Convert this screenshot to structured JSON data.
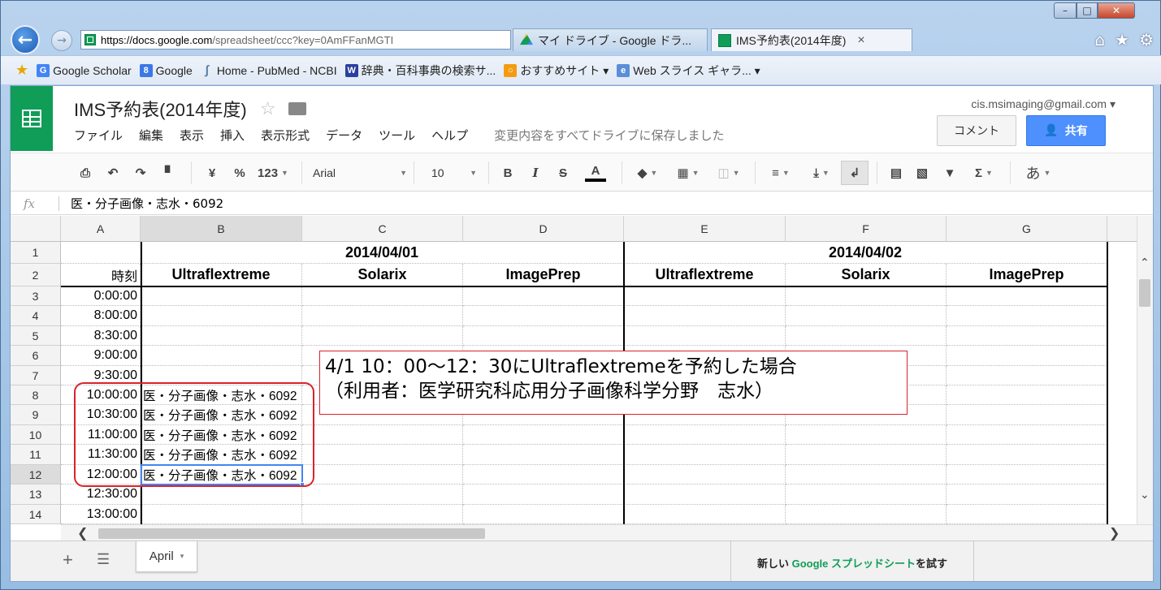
{
  "browser": {
    "url_host": "https://docs.google.com",
    "url_rest": "/spreadsheet/ccc?key=0AmFFanMGTI",
    "tabs": [
      {
        "label": "マイ ドライブ - Google ドラ..."
      },
      {
        "label": "IMS予約表(2014年度)"
      }
    ],
    "tab_close": "×",
    "window_controls": {
      "minimize": "–",
      "maximize": "□",
      "close": "✕"
    }
  },
  "favorites": [
    {
      "label": "Google Scholar",
      "icon": "google-scholar-icon",
      "color": "#4285f4"
    },
    {
      "label": "Google",
      "icon": "google-icon",
      "color": "#3b78e7"
    },
    {
      "label": "Home - PubMed - NCBI",
      "icon": "pubmed-icon",
      "color": "#5a7fa8"
    },
    {
      "label": "辞典・百科事典の検索サ...",
      "icon": "weblio-icon",
      "color": "#2b3f9c"
    },
    {
      "label": "おすすめサイト ▾",
      "icon": "suggested-sites-icon",
      "color": "#f39c12"
    },
    {
      "label": "Web スライス ギャラ... ▾",
      "icon": "web-slice-icon",
      "color": "#5a8fd8"
    }
  ],
  "app": {
    "doc_title": "IMS予約表(2014年度)",
    "account": "cis.msimaging@gmail.com ▾",
    "comment_label": "コメント",
    "share_label": "共有",
    "menu": [
      "ファイル",
      "編集",
      "表示",
      "挿入",
      "表示形式",
      "データ",
      "ツール",
      "ヘルプ"
    ],
    "save_status": "変更内容をすべてドライブに保存しました"
  },
  "toolbar": {
    "currency": "¥",
    "percent": "%",
    "number_format": "123",
    "font": "Arial",
    "font_size": "10",
    "bold": "B",
    "italic": "I",
    "strike": "S",
    "text_color": "A",
    "sum": "Σ",
    "input_tools": "あ"
  },
  "formula_bar": {
    "fx": "fx",
    "value": "医・分子画像・志水・6092"
  },
  "columns": [
    "A",
    "B",
    "C",
    "D",
    "E",
    "F",
    "G"
  ],
  "rows": [
    "1",
    "2",
    "3",
    "4",
    "5",
    "6",
    "7",
    "8",
    "9",
    "10",
    "11",
    "12",
    "13",
    "14"
  ],
  "sheet": {
    "date1": "2014/04/01",
    "date2": "2014/04/02",
    "time_header": "時刻",
    "instruments": [
      "Ultraflextreme",
      "Solarix",
      "ImagePrep",
      "Ultraflextreme",
      "Solarix",
      "ImagePrep"
    ],
    "times": [
      "0:00:00",
      "8:00:00",
      "8:30:00",
      "9:00:00",
      "9:30:00",
      "10:00:00",
      "10:30:00",
      "11:00:00",
      "11:30:00",
      "12:00:00",
      "12:30:00",
      "13:00:00"
    ],
    "bookings_b": [
      "",
      "",
      "",
      "",
      "",
      "医・分子画像・志水・6092",
      "医・分子画像・志水・6092",
      "医・分子画像・志水・6092",
      "医・分子画像・志水・6092",
      "医・分子画像・志水・6092",
      "",
      ""
    ]
  },
  "annotation": {
    "line1": "4/1 10：00～12：30にUltraflextremeを予約した場合",
    "line2": "（利用者：医学研究科応用分子画像科学分野　志水）",
    "color": "#d9232d"
  },
  "sheet_tabs": {
    "active": "April",
    "caret": "▾",
    "try_new_prefix": "新しい",
    "try_new_brand": "Google スプレッドシート",
    "try_new_suffix": "を試す"
  }
}
